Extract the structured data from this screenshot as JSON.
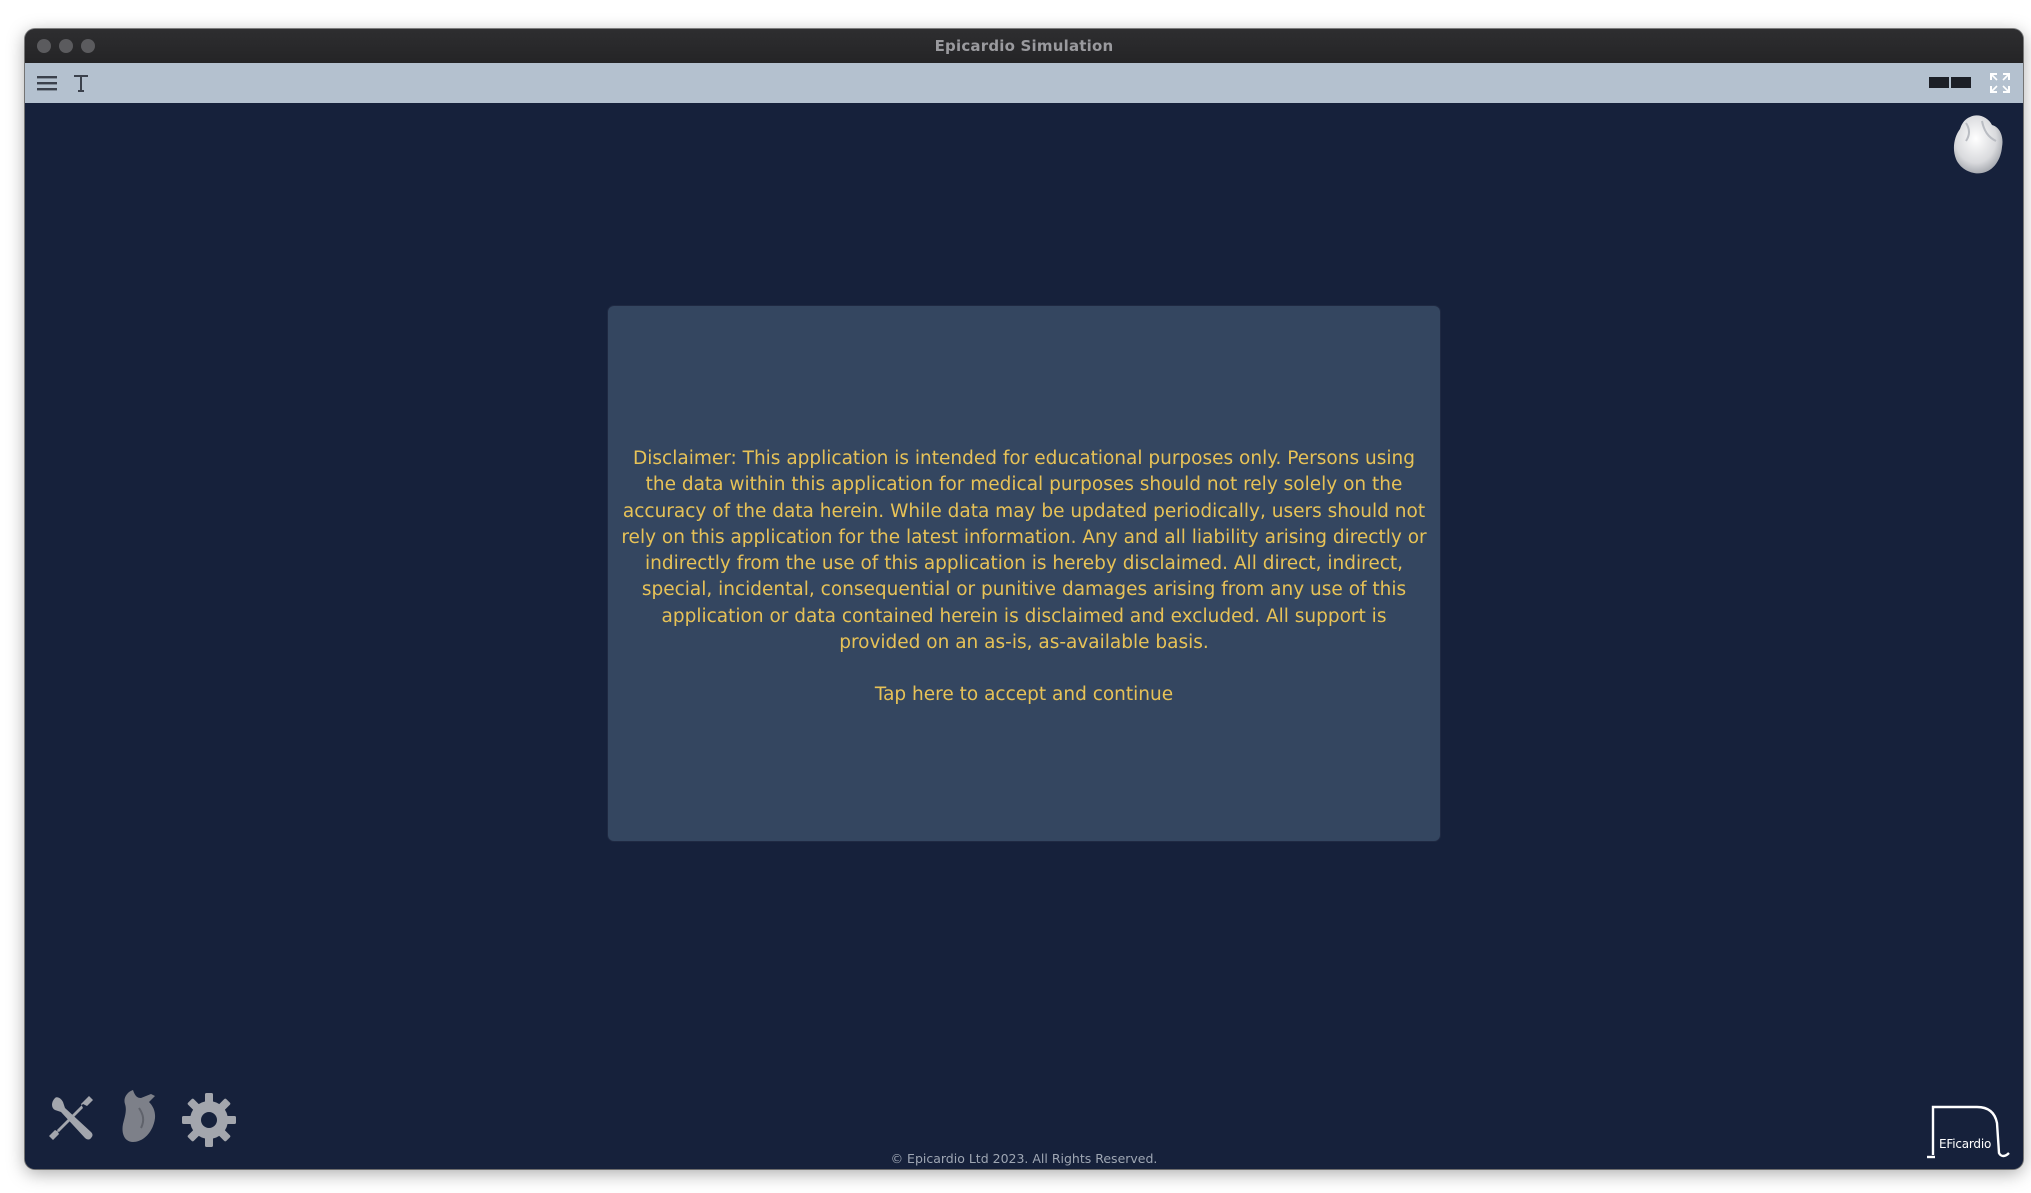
{
  "window": {
    "title": "Epicardio Simulation"
  },
  "toolbar": {
    "menu_icon": "hamburger-menu-icon",
    "text_icon": "text-T-icon",
    "layout_icon": "split-layout-icon",
    "fullscreen_icon": "fullscreen-icon"
  },
  "dialog": {
    "disclaimer": "Disclaimer:  This application is intended for educational purposes only.  Persons using the data within this application for medical purposes should not rely solely on the accuracy of the data herein.  While data may be updated periodically, users should not rely on this application for the latest information.  Any and all liability arising directly or indirectly from the use of this application is hereby disclaimed.  All direct, indirect, special, incidental, consequential or punitive damages arising from any use of this application or data contained herein is disclaimed and excluded.  All support is provided on an as-is, as-available basis.",
    "accept_label": "Tap here to accept and continue"
  },
  "footer": {
    "copyright": "© Epicardio Ltd 2023. All Rights Reserved."
  },
  "brand": {
    "label": "EFicardio"
  },
  "colors": {
    "background": "#16213b",
    "dialog": "#344660",
    "text_accent": "#e7c257",
    "toolbar": "#b4c1cf"
  },
  "icons": {
    "top_right": "heart-model-icon",
    "bottom_left": [
      "tools-icon",
      "heart-icon",
      "gear-icon"
    ]
  }
}
